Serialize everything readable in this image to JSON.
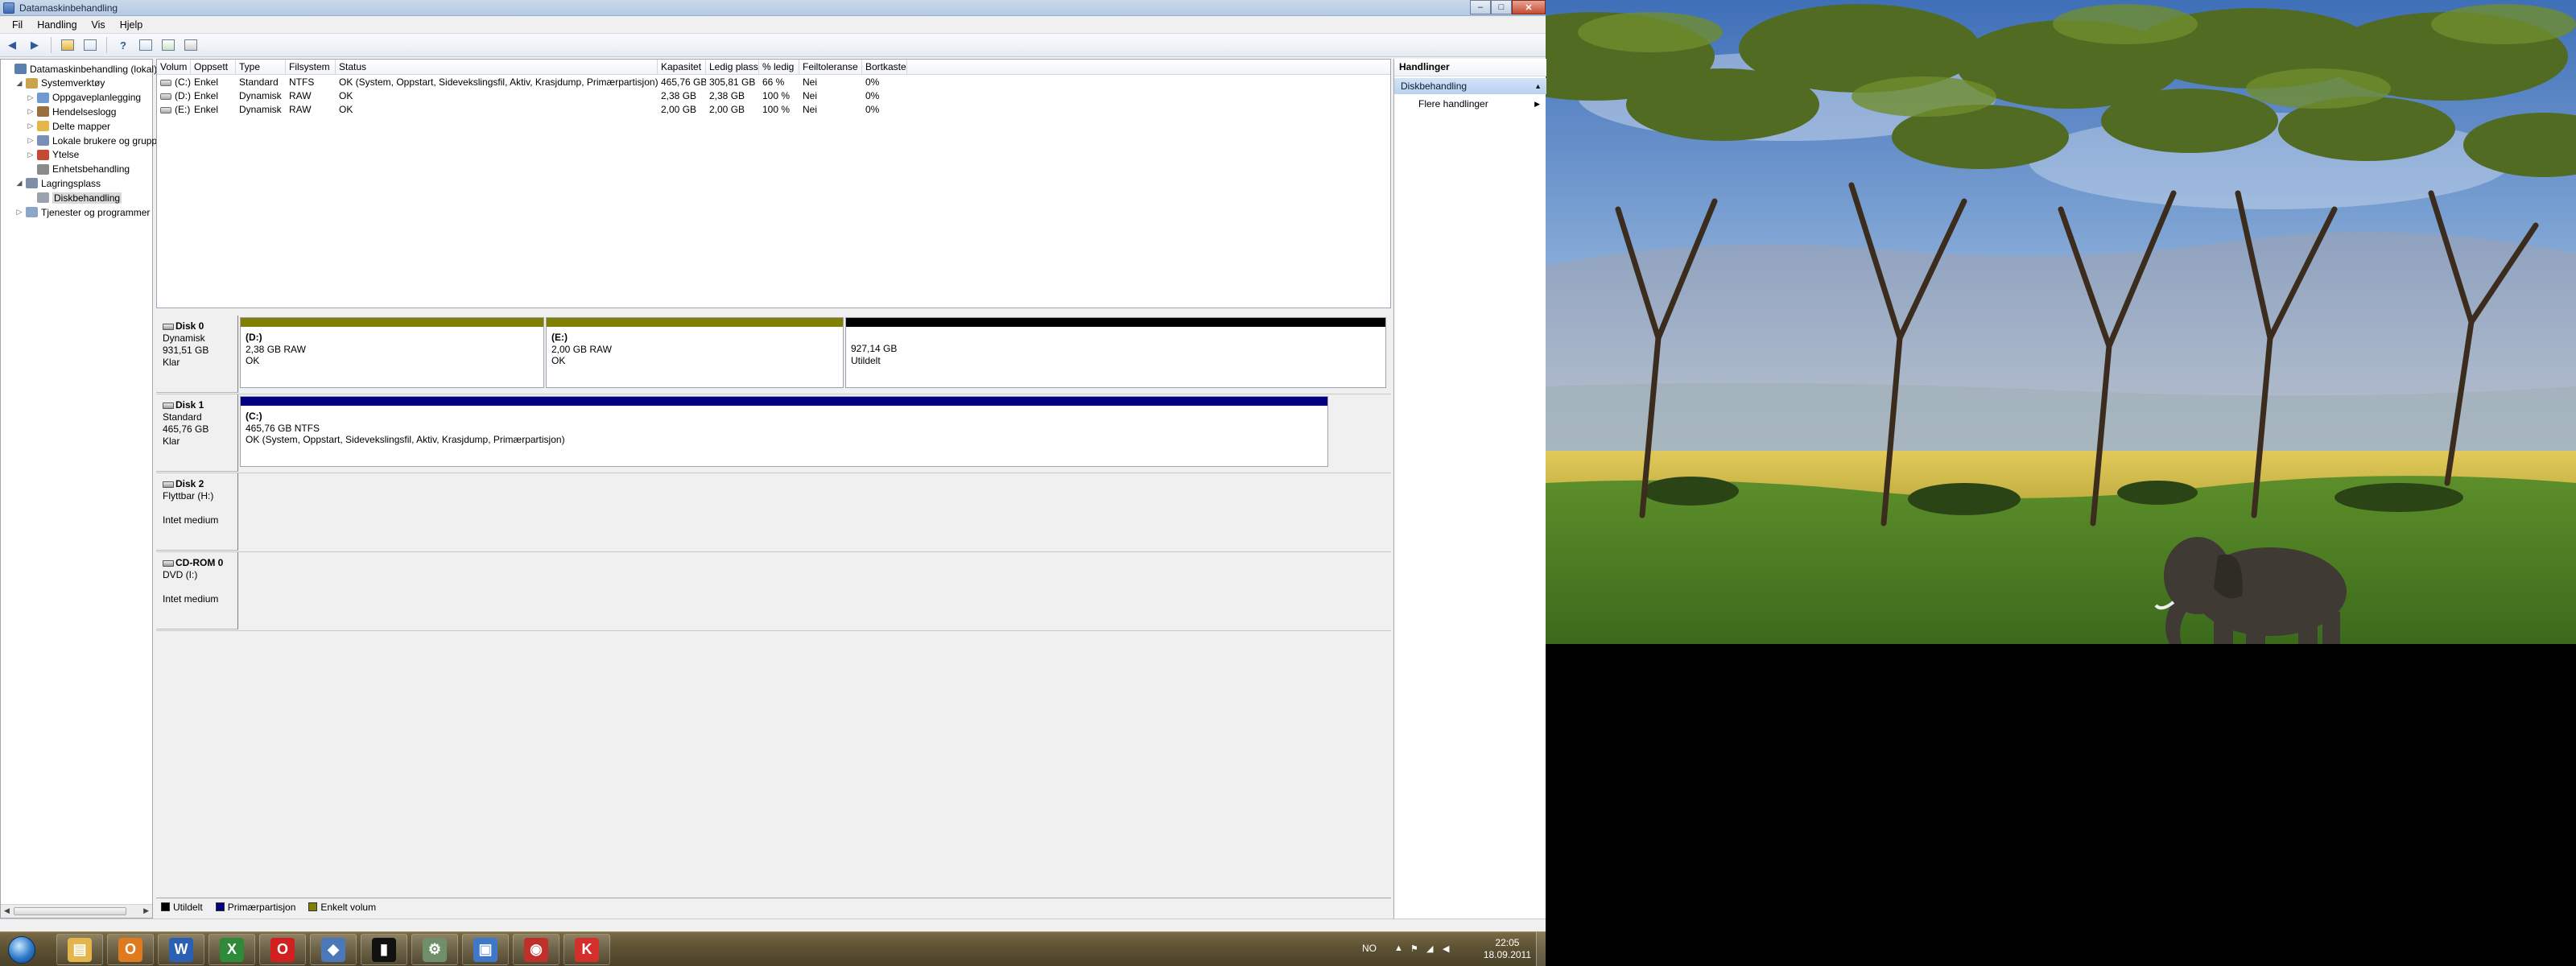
{
  "window": {
    "title": "Datamaskinbehandling",
    "controls": [
      "–",
      "□",
      "✕"
    ]
  },
  "menu": [
    "Fil",
    "Handling",
    "Vis",
    "Hjelp"
  ],
  "toolbar": [
    "back",
    "forward",
    "up",
    "show-hide-tree",
    "help",
    "properties",
    "refresh",
    "export"
  ],
  "tree": [
    {
      "label": "Datamaskinbehandling (lokal)",
      "level": 0,
      "toggle": "",
      "icon": "computer"
    },
    {
      "label": "Systemverktøy",
      "level": 1,
      "toggle": "◢",
      "icon": "tools"
    },
    {
      "label": "Oppgaveplanlegging",
      "level": 2,
      "toggle": "▷",
      "icon": "clock"
    },
    {
      "label": "Hendelseslogg",
      "level": 2,
      "toggle": "▷",
      "icon": "log"
    },
    {
      "label": "Delte mapper",
      "level": 2,
      "toggle": "▷",
      "icon": "folder"
    },
    {
      "label": "Lokale brukere og grupp",
      "level": 2,
      "toggle": "▷",
      "icon": "users"
    },
    {
      "label": "Ytelse",
      "level": 2,
      "toggle": "▷",
      "icon": "perf"
    },
    {
      "label": "Enhetsbehandling",
      "level": 2,
      "toggle": "",
      "icon": "device"
    },
    {
      "label": "Lagringsplass",
      "level": 1,
      "toggle": "◢",
      "icon": "storage"
    },
    {
      "label": "Diskbehandling",
      "level": 2,
      "toggle": "",
      "icon": "disk",
      "selected": true
    },
    {
      "label": "Tjenester og programmer",
      "level": 1,
      "toggle": "▷",
      "icon": "services"
    }
  ],
  "volume_table": {
    "columns": [
      "Volum",
      "Oppsett",
      "Type",
      "Filsystem",
      "Status",
      "Kapasitet",
      "Ledig plass",
      "% ledig",
      "Feiltoleranse",
      "Bortkastet"
    ],
    "rows": [
      [
        "(C:)",
        "Enkel",
        "Standard",
        "NTFS",
        "OK (System, Oppstart, Sidevekslingsfil, Aktiv, Krasjdump, Primærpartisjon)",
        "465,76 GB",
        "305,81 GB",
        "66 %",
        "Nei",
        "0%"
      ],
      [
        "(D:)",
        "Enkel",
        "Dynamisk",
        "RAW",
        "OK",
        "2,38 GB",
        "2,38 GB",
        "100 %",
        "Nei",
        "0%"
      ],
      [
        "(E:)",
        "Enkel",
        "Dynamisk",
        "RAW",
        "OK",
        "2,00 GB",
        "2,00 GB",
        "100 %",
        "Nei",
        "0%"
      ]
    ]
  },
  "disks": [
    {
      "name": "Disk 0",
      "lines": [
        "Dynamisk",
        "931,51 GB",
        "Klar"
      ],
      "partitions": [
        {
          "name": "(D:)",
          "line1": "2,38 GB RAW",
          "line2": "OK",
          "color": "#808000"
        },
        {
          "name": "(E:)",
          "line1": "2,00 GB RAW",
          "line2": "OK",
          "color": "#808000"
        },
        {
          "name": "",
          "line1": "927,14 GB",
          "line2": "Utildelt",
          "color": "#000000"
        }
      ]
    },
    {
      "name": "Disk 1",
      "lines": [
        "Standard",
        "465,76 GB",
        "Klar"
      ],
      "partitions": [
        {
          "name": "(C:)",
          "line1": "465,76 GB NTFS",
          "line2": "OK (System, Oppstart, Sidevekslingsfil, Aktiv, Krasjdump, Primærpartisjon)",
          "color": "#000080"
        }
      ]
    },
    {
      "name": "Disk 2",
      "lines": [
        "Flyttbar (H:)",
        "",
        "Intet medium"
      ],
      "partitions": []
    },
    {
      "name": "CD-ROM 0",
      "lines": [
        "DVD (I:)",
        "",
        "Intet medium"
      ],
      "partitions": []
    }
  ],
  "legend": [
    {
      "label": "Utildelt",
      "color": "#000000"
    },
    {
      "label": "Primærpartisjon",
      "color": "#000080"
    },
    {
      "label": "Enkelt volum",
      "color": "#808000"
    }
  ],
  "actions": {
    "header": "Handlinger",
    "section": "Diskbehandling",
    "more": "Flere handlinger"
  },
  "taskbar": {
    "apps": [
      {
        "icon": "explorer-icon",
        "color": "#e3b54a",
        "glyph": "▤"
      },
      {
        "icon": "outlook-icon",
        "color": "#e07a1f",
        "glyph": "O"
      },
      {
        "icon": "word-icon",
        "color": "#2b5fb3",
        "glyph": "W"
      },
      {
        "icon": "excel-icon",
        "color": "#2f8a3a",
        "glyph": "X"
      },
      {
        "icon": "opera-icon",
        "color": "#d21f1f",
        "glyph": "O"
      },
      {
        "icon": "network-icon",
        "color": "#4a78b8",
        "glyph": "◆"
      },
      {
        "icon": "cmd-icon",
        "color": "#111111",
        "glyph": "▮"
      },
      {
        "icon": "computer-management-icon",
        "color": "#6f8f6a",
        "glyph": "⚙"
      },
      {
        "icon": "window-icon",
        "color": "#3f78c9",
        "glyph": "▣"
      },
      {
        "icon": "car-app-icon",
        "color": "#c0302a",
        "glyph": "◉"
      },
      {
        "icon": "kaspersky-icon",
        "color": "#d4302b",
        "glyph": "K"
      }
    ],
    "language": "NO",
    "time": "22:05",
    "date": "18.09.2011"
  }
}
